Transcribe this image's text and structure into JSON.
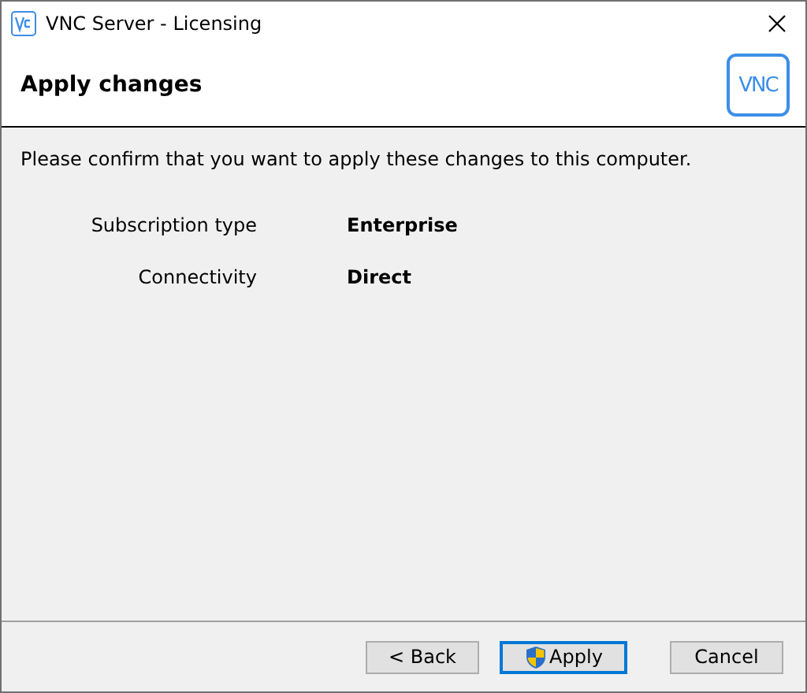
{
  "window": {
    "title": "VNC Server - Licensing"
  },
  "header": {
    "title": "Apply changes",
    "logo": "VNC"
  },
  "message": "Please confirm that you want to apply these changes to this computer.",
  "fields": [
    {
      "label": "Subscription type",
      "value": "Enterprise"
    },
    {
      "label": "Connectivity",
      "value": "Direct"
    }
  ],
  "buttons": [
    {
      "label": "< Back",
      "default": false,
      "shield": false
    },
    {
      "label": "Apply",
      "default": true,
      "shield": true
    },
    {
      "label": "Cancel",
      "default": false,
      "shield": false
    }
  ]
}
